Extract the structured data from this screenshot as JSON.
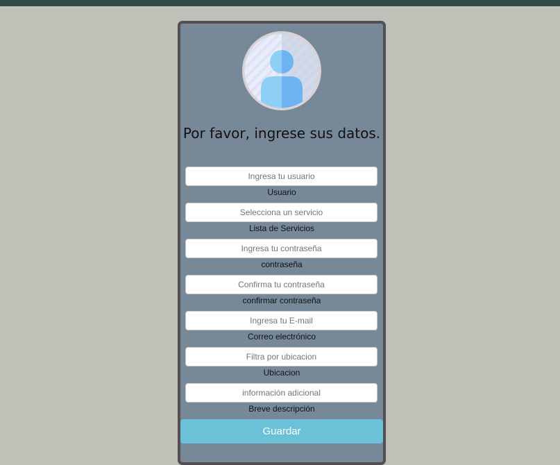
{
  "header": {
    "bar_color": "#2f4b48"
  },
  "form": {
    "avatar_icon": "user-avatar-icon",
    "title": "Por favor, ingrese sus datos.",
    "fields": [
      {
        "placeholder": "Ingresa tu usuario",
        "label": "Usuario"
      },
      {
        "placeholder": "Selecciona un servicio",
        "label": "Lista de Servicios"
      },
      {
        "placeholder": "Ingresa tu contraseña",
        "label": "contraseña"
      },
      {
        "placeholder": "Confirma tu contraseña",
        "label": "confirmar contraseña"
      },
      {
        "placeholder": "Ingresa tu E-mail",
        "label": "Correo electrónico"
      },
      {
        "placeholder": "Filtra por ubicacion",
        "label": "Ubicacion"
      },
      {
        "placeholder": "información adicional",
        "label": "Breve descripción"
      }
    ],
    "save_label": "Guardar"
  },
  "colors": {
    "page_background": "#bec1b8",
    "card_background": "#778899",
    "card_border": "#544f52",
    "button": "#6bc1d7"
  }
}
